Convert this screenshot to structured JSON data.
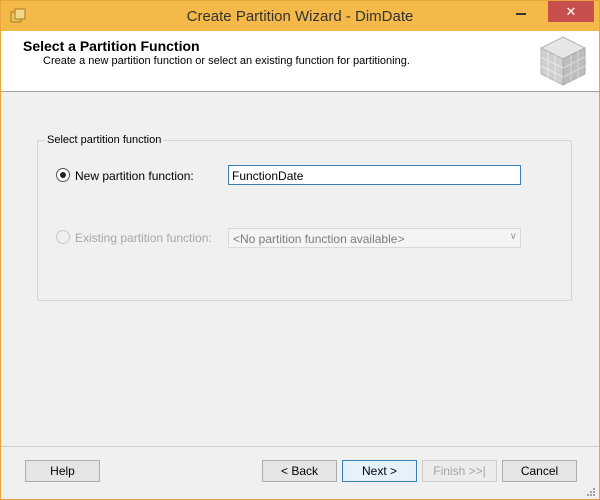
{
  "window": {
    "title": "Create Partition Wizard - DimDate",
    "close_glyph": "✕"
  },
  "header": {
    "title": "Select a Partition Function",
    "subtitle": "Create a new partition function or select an existing function for partitioning."
  },
  "group": {
    "label": "Select partition function",
    "new_option_label": "New partition function:",
    "new_function_value": "FunctionDate",
    "existing_option_label": "Existing partition function:",
    "existing_function_value": "<No partition function available>"
  },
  "buttons": {
    "help": "Help",
    "back": "< Back",
    "next": "Next >",
    "finish": "Finish >>|",
    "cancel": "Cancel"
  },
  "colors": {
    "titlebar": "#f5b94a",
    "close": "#c7504e",
    "focus_border": "#3c7fb1"
  },
  "icons": [
    "app-icon",
    "minimize-icon",
    "close-icon",
    "cube-icon",
    "combo-arrow-icon",
    "resize-grip-icon"
  ]
}
